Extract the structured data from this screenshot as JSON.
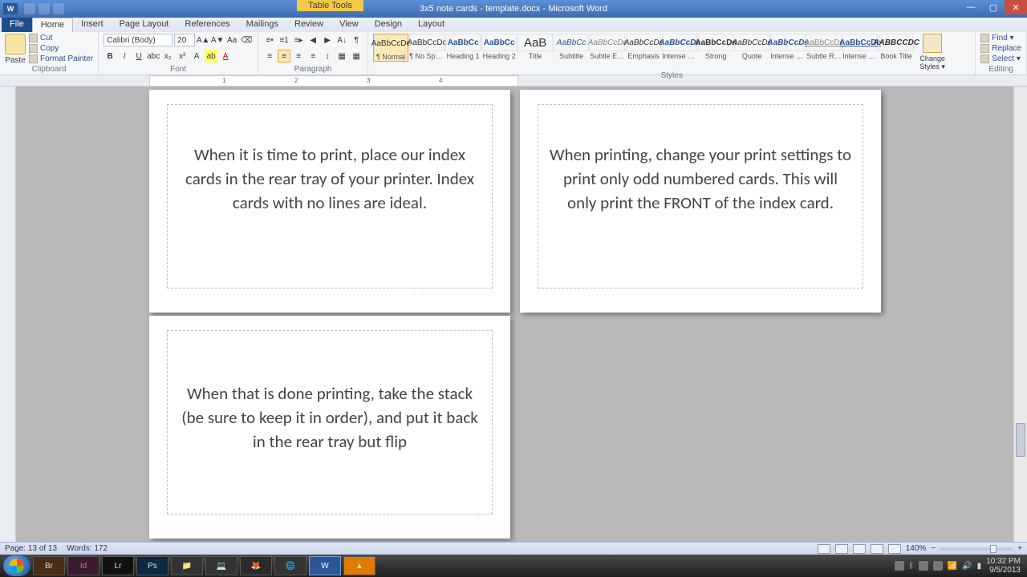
{
  "title": {
    "tableTools": "Table Tools",
    "doc": "3x5 note cards - template.docx - Microsoft Word"
  },
  "tabs": {
    "file": "File",
    "home": "Home",
    "insert": "Insert",
    "pageLayout": "Page Layout",
    "references": "References",
    "mailings": "Mailings",
    "review": "Review",
    "view": "View",
    "design": "Design",
    "layout": "Layout"
  },
  "ribbon": {
    "clipboard": {
      "label": "Clipboard",
      "paste": "Paste",
      "cut": "Cut",
      "copy": "Copy",
      "formatPainter": "Format Painter"
    },
    "font": {
      "label": "Font",
      "name": "Calibri (Body)",
      "size": "20"
    },
    "paragraph": {
      "label": "Paragraph"
    },
    "styles": {
      "label": "Styles",
      "items": [
        {
          "prev": "AaBbCcDc",
          "name": "¶ Normal"
        },
        {
          "prev": "AaBbCcDc",
          "name": "¶ No Spaci..."
        },
        {
          "prev": "AaBbCc",
          "name": "Heading 1"
        },
        {
          "prev": "AaBbCc",
          "name": "Heading 2"
        },
        {
          "prev": "AaB",
          "name": "Title"
        },
        {
          "prev": "AaBbCc",
          "name": "Subtitle"
        },
        {
          "prev": "AaBbCcDc",
          "name": "Subtle Em..."
        },
        {
          "prev": "AaBbCcDc",
          "name": "Emphasis"
        },
        {
          "prev": "AaBbCcDc",
          "name": "Intense E..."
        },
        {
          "prev": "AaBbCcDc",
          "name": "Strong"
        },
        {
          "prev": "AaBbCcDc",
          "name": "Quote"
        },
        {
          "prev": "AaBbCcDc",
          "name": "Intense Q..."
        },
        {
          "prev": "AaBbCcDc",
          "name": "Subtle Ref..."
        },
        {
          "prev": "AaBbCcDc",
          "name": "Intense R..."
        },
        {
          "prev": "AABBCCDC",
          "name": "Book Title"
        }
      ],
      "change": "Change Styles ▾"
    },
    "editing": {
      "label": "Editing",
      "find": "Find ▾",
      "replace": "Replace",
      "select": "Select ▾"
    }
  },
  "cards": {
    "c1": "When it is time to print, place our index cards in the rear tray of your printer.  Index cards with no lines are ideal.",
    "c2": "When printing, change your print settings to print only odd numbered cards.  This will only print the FRONT of the index card.",
    "c3": "When that is done printing, take the stack (be sure to keep it in order), and put it back in the rear tray but flip"
  },
  "status": {
    "page": "Page: 13 of 13",
    "words": "Words: 172",
    "zoom": "140%"
  },
  "tray": {
    "time": "10:32 PM",
    "date": "9/5/2013"
  }
}
